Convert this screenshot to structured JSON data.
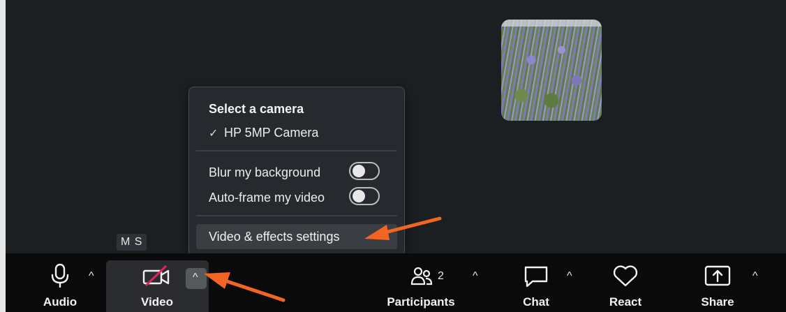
{
  "popup": {
    "heading": "Select a camera",
    "camera_item": "HP 5MP Camera",
    "blur_label": "Blur my background",
    "autoframe_label": "Auto-frame my video",
    "settings_label": "Video & effects settings"
  },
  "name_tag": "M S",
  "toolbar": {
    "audio_label": "Audio",
    "video_label": "Video",
    "participants_label": "Participants",
    "participants_count": "2",
    "chat_label": "Chat",
    "react_label": "React",
    "share_label": "Share"
  },
  "colors": {
    "annotation_arrow": "#f26522",
    "muted_slash": "#e0245e"
  },
  "icons": [
    "microphone-icon",
    "video-off-icon",
    "participants-icon",
    "chat-icon",
    "heart-icon",
    "share-icon",
    "chevron-up-icon",
    "check-icon"
  ]
}
